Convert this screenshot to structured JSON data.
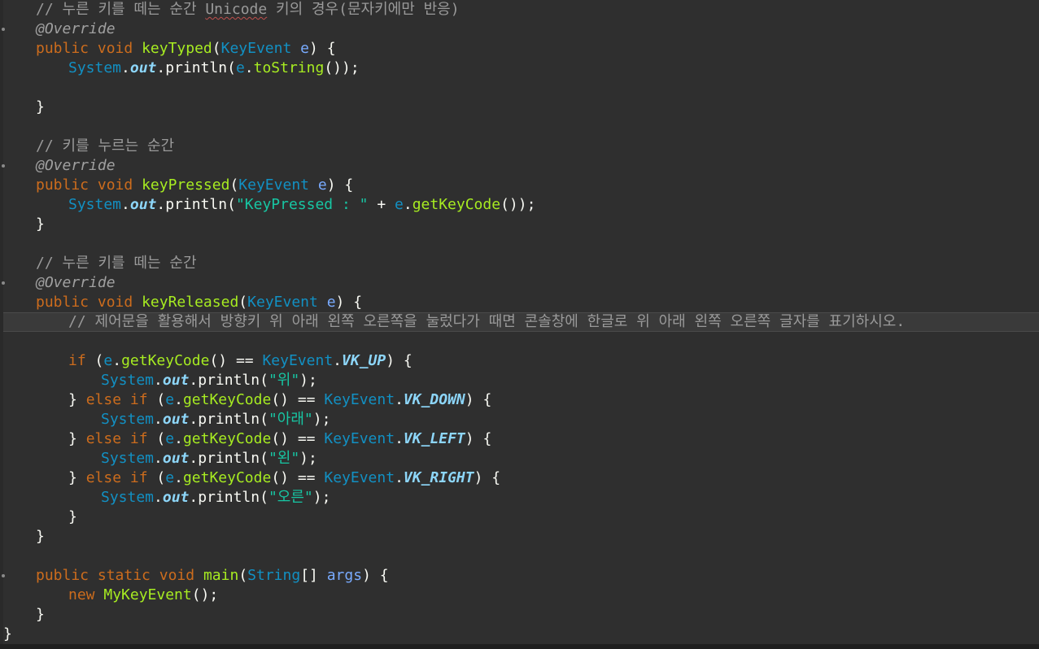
{
  "editor": {
    "lines": {
      "l1_comment_a": "// 누른 키를 떼는 순간 ",
      "l1_comment_unicode": "Unicode",
      "l1_comment_b": " 키의 경우(문자키에만 반응)",
      "l2_anno": "@Override",
      "l3_public": "public",
      "l3_void": "void",
      "l3_method": "keyTyped",
      "l3_type": "KeyEvent",
      "l3_param": "e",
      "l4_system": "System",
      "l4_out": "out",
      "l4_println": "println",
      "l4_var": "e",
      "l4_tostring": "toString",
      "l6_brace": "}",
      "l8_comment": "// 키를 누르는 순간",
      "l9_anno": "@Override",
      "l10_public": "public",
      "l10_void": "void",
      "l10_method": "keyPressed",
      "l10_type": "KeyEvent",
      "l10_param": "e",
      "l11_system": "System",
      "l11_out": "out",
      "l11_println": "println",
      "l11_str": "\"KeyPressed : \"",
      "l11_var": "e",
      "l11_getkeycode": "getKeyCode",
      "l12_brace": "}",
      "l14_comment": "// 누른 키를 떼는 순간",
      "l15_anno": "@Override",
      "l16_public": "public",
      "l16_void": "void",
      "l16_method": "keyReleased",
      "l16_type": "KeyEvent",
      "l16_param": "e",
      "l17_comment": "// 제어문을 활용해서 방향키 위 아래 왼쪽 오른쪽을 눌렀다가 때면 콘솔창에 한글로 위 아래 왼쪽 오른쪽 글자를 표기하시오.",
      "l19_if": "if",
      "l19_var": "e",
      "l19_getkeycode": "getKeyCode",
      "l19_type": "KeyEvent",
      "l19_field": "VK_UP",
      "l20_system": "System",
      "l20_out": "out",
      "l20_println": "println",
      "l20_str": "\"위\"",
      "l21_else": "else",
      "l21_if": "if",
      "l21_var": "e",
      "l21_getkeycode": "getKeyCode",
      "l21_type": "KeyEvent",
      "l21_field": "VK_DOWN",
      "l22_system": "System",
      "l22_out": "out",
      "l22_println": "println",
      "l22_str": "\"아래\"",
      "l23_else": "else",
      "l23_if": "if",
      "l23_var": "e",
      "l23_getkeycode": "getKeyCode",
      "l23_type": "KeyEvent",
      "l23_field": "VK_LEFT",
      "l24_system": "System",
      "l24_out": "out",
      "l24_println": "println",
      "l24_str": "\"왼\"",
      "l25_else": "else",
      "l25_if": "if",
      "l25_var": "e",
      "l25_getkeycode": "getKeyCode",
      "l25_type": "KeyEvent",
      "l25_field": "VK_RIGHT",
      "l26_system": "System",
      "l26_out": "out",
      "l26_println": "println",
      "l26_str": "\"오른\"",
      "l27_brace": "}",
      "l28_brace": "}",
      "l30_public": "public",
      "l30_static": "static",
      "l30_void": "void",
      "l30_method": "main",
      "l30_type": "String",
      "l30_param": "args",
      "l31_new": "new",
      "l31_class": "MyKeyEvent",
      "l32_brace": "}",
      "l33_brace": "}"
    }
  },
  "colors": {
    "background": "#2f2f2f",
    "keyword": "#cc6c1d",
    "type": "#1290c3",
    "method": "#a7ec21",
    "string": "#17c6a3",
    "comment": "#9a9a9a",
    "field": "#8dd6f9"
  }
}
